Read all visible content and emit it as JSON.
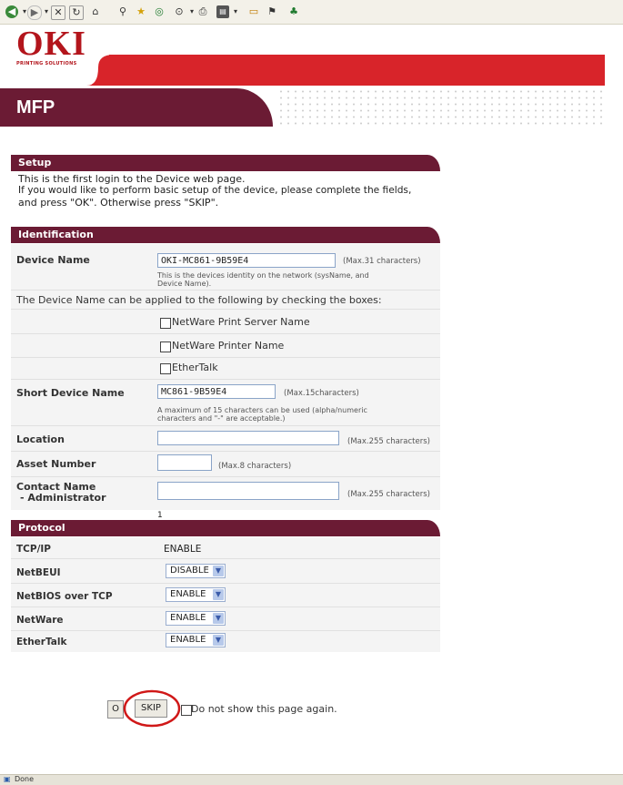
{
  "brand": {
    "logo_text": "OKI",
    "logo_sub": "PRINTING SOLUTIONS",
    "product": "MFP",
    "accent_color": "#6b1b34",
    "brand_red": "#d8242a"
  },
  "toolbar": {
    "icons": [
      "back-icon",
      "forward-icon",
      "stop-icon",
      "refresh-icon",
      "home-icon",
      "search-icon",
      "favorites-icon",
      "media-icon",
      "mail-icon",
      "print-icon",
      "edit-icon",
      "discuss-icon",
      "messenger-icon",
      "research-icon"
    ]
  },
  "setup": {
    "header": "Setup",
    "line1": "This is the first login to the Device web page.",
    "line2": "If you would like to perform basic setup of the device, please complete the fields,",
    "line3": "and press \"OK\". Otherwise press \"SKIP\"."
  },
  "identification": {
    "header": "Identification",
    "device_name_label": "Device Name",
    "device_name_value": "OKI-MC861-9B59E4",
    "device_name_hint": "(Max.31 characters)",
    "device_name_note1": "This is the devices identity on the network (sysName, and",
    "device_name_note2": "Device Name).",
    "apply_text": "The Device Name can be applied to the following by checking the boxes:",
    "opt_netware_server": "NetWare Print Server Name",
    "opt_netware_printer": "NetWare Printer Name",
    "opt_ethertalk": "EtherTalk",
    "short_name_label": "Short Device Name",
    "short_name_value": "MC861-9B59E4",
    "short_name_hint": "(Max.15characters)",
    "short_name_note1": "A maximum of 15 characters can be used (alpha/numeric",
    "short_name_note2": "characters and \"-\" are acceptable.)",
    "location_label": "Location",
    "location_value": "",
    "location_hint": "(Max.255 characters)",
    "asset_label": "Asset Number",
    "asset_value": "",
    "asset_hint": "(Max.8 characters)",
    "contact_label1": "Contact Name",
    "contact_label2": "- Administrator",
    "contact_value": "",
    "contact_hint": "(Max.255 characters)"
  },
  "protocol": {
    "header": "Protocol",
    "marker": "1",
    "tcpip_label": "TCP/IP",
    "tcpip_value": "ENABLE",
    "netbeui_label": "NetBEUI",
    "netbeui_value": "DISABLE",
    "netbios_label": "NetBIOS over TCP",
    "netbios_value": "ENABLE",
    "netware_label": "NetWare",
    "netware_value": "ENABLE",
    "ethertalk_label": "EtherTalk",
    "ethertalk_value": "ENABLE"
  },
  "actions": {
    "ok_label": "O",
    "skip_label": "SKIP",
    "dont_show_label": "Do not show this page again.",
    "highlight_color": "#d01818"
  },
  "status": {
    "text": "Done"
  }
}
